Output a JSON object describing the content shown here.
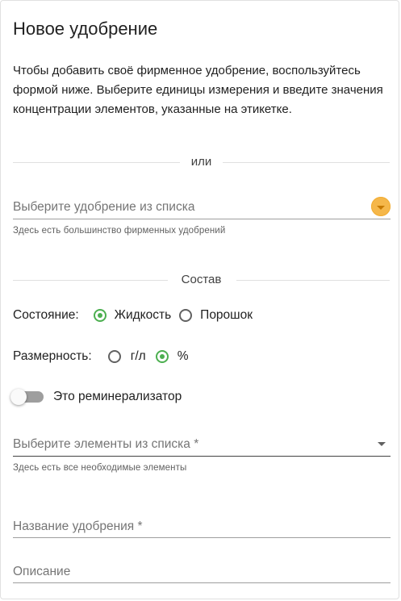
{
  "form": {
    "title": "Новое удобрение",
    "intro": "Чтобы добавить своё фирменное удобрение, воспользуйтесь формой ниже. Выберите единицы измерения и введите значения концентрации элементов, указанные на этикетке.",
    "divider_or": "или",
    "fertilizer_select": {
      "placeholder": "Выберите удобрение из списка",
      "hint": "Здесь есть большинство фирменных удобрений"
    },
    "composition_heading": "Состав",
    "state": {
      "label": "Состояние:",
      "options": [
        {
          "label": "Жидкость",
          "checked": true
        },
        {
          "label": "Порошок",
          "checked": false
        }
      ]
    },
    "units": {
      "label": "Размерность:",
      "options": [
        {
          "label": "г/л",
          "checked": false
        },
        {
          "label": "%",
          "checked": true
        }
      ]
    },
    "remineralizer": {
      "label": "Это реминерализатор",
      "on": false
    },
    "elements_select": {
      "placeholder": "Выберите элементы из списка *",
      "hint": "Здесь есть все необходимые элементы"
    },
    "name_field": {
      "placeholder": "Название удобрения *"
    },
    "description_field": {
      "placeholder": "Описание"
    }
  },
  "colors": {
    "accent_green": "#4caf50",
    "accent_orange": "#f5b74a"
  },
  "icons": {
    "fertilizer_dropdown": "chevron-down-icon",
    "elements_dropdown": "arrow-drop-down-icon"
  }
}
